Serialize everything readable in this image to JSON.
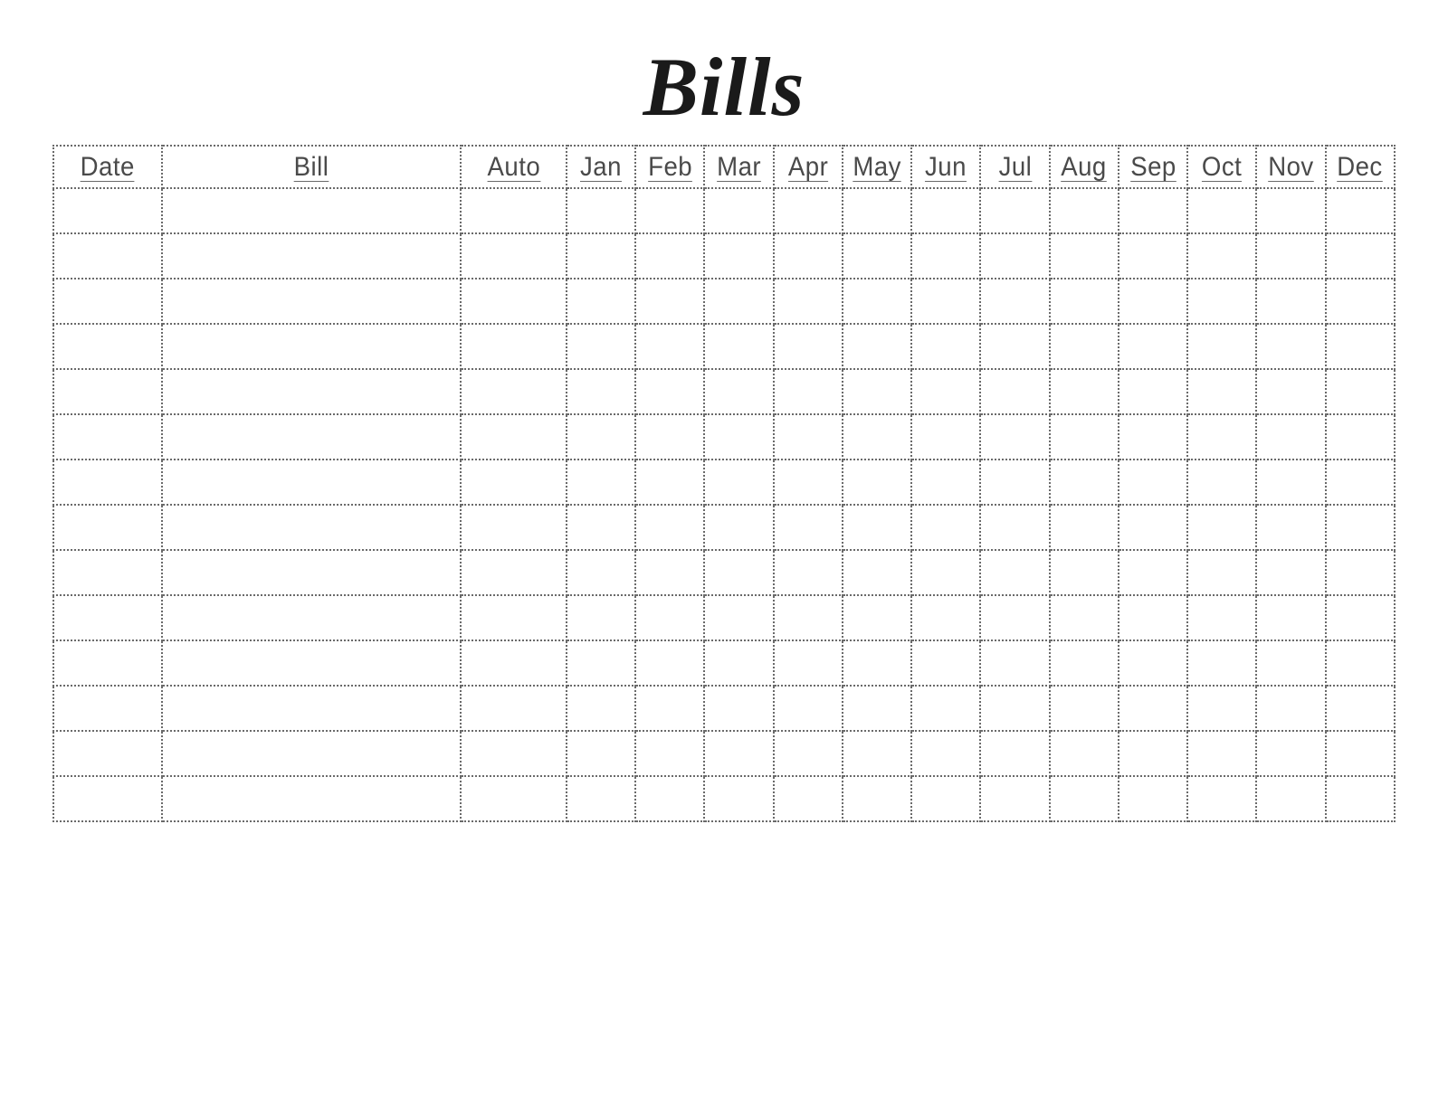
{
  "title": "Bills",
  "columns": {
    "date": "Date",
    "bill": "Bill",
    "auto": "Auto",
    "months": [
      "Jan",
      "Feb",
      "Mar",
      "Apr",
      "May",
      "Jun",
      "Jul",
      "Aug",
      "Sep",
      "Oct",
      "Nov",
      "Dec"
    ]
  },
  "row_count": 14
}
